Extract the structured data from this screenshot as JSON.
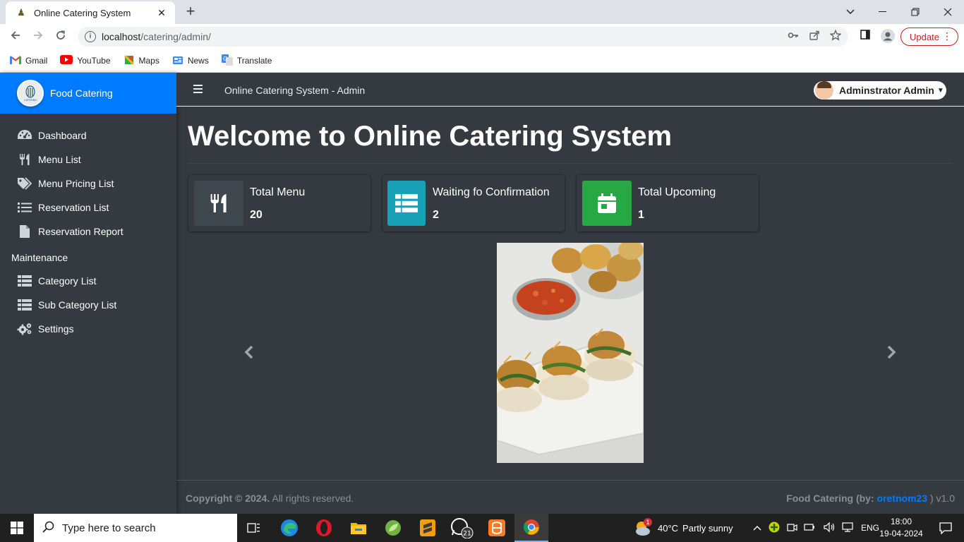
{
  "browser": {
    "tab_title": "Online Catering System",
    "url_host": "localhost",
    "url_path": "/catering/admin/",
    "update_label": "Update",
    "bookmarks": [
      {
        "label": "Gmail",
        "icon": "gmail-icon",
        "color": "#ea4335"
      },
      {
        "label": "YouTube",
        "icon": "youtube-icon",
        "color": "#ff0000"
      },
      {
        "label": "Maps",
        "icon": "maps-icon",
        "color": "#34a853"
      },
      {
        "label": "News",
        "icon": "news-icon",
        "color": "#4285f4"
      },
      {
        "label": "Translate",
        "icon": "translate-icon",
        "color": "#4285f4"
      }
    ]
  },
  "sidebar": {
    "brand": "Food Catering",
    "logo_text": "CATERING",
    "items": [
      {
        "label": "Dashboard",
        "icon": "dashboard-icon"
      },
      {
        "label": "Menu List",
        "icon": "utensils-icon"
      },
      {
        "label": "Menu Pricing List",
        "icon": "tags-icon"
      },
      {
        "label": "Reservation List",
        "icon": "list-icon"
      },
      {
        "label": "Reservation Report",
        "icon": "file-icon"
      }
    ],
    "maintenance_header": "Maintenance",
    "maintenance_items": [
      {
        "label": "Category List",
        "icon": "table-icon"
      },
      {
        "label": "Sub Category List",
        "icon": "table-icon"
      },
      {
        "label": "Settings",
        "icon": "gears-icon"
      }
    ]
  },
  "topnav": {
    "title": "Online Catering System - Admin",
    "user": "Adminstrator Admin"
  },
  "main": {
    "heading": "Welcome to Online Catering System",
    "info_boxes": [
      {
        "label": "Total Menu",
        "value": "20",
        "icon": "utensils-icon",
        "color": "#3f474e"
      },
      {
        "label": "Waiting fo Confirmation",
        "value": "2",
        "icon": "table-list-icon",
        "color": "#17a2b8"
      },
      {
        "label": "Total Upcoming",
        "value": "1",
        "icon": "calendar-icon",
        "color": "#28a745"
      }
    ]
  },
  "footer": {
    "copyright_bold": "Copyright © 2024.",
    "copyright_rest": " All rights reserved.",
    "credit_prefix": "Food Catering (by: ",
    "credit_link": "oretnom23",
    "credit_suffix": " ) v1.0"
  },
  "taskbar": {
    "search_placeholder": "Type here to search",
    "weather_temp": "40°C",
    "weather_desc": "Partly sunny",
    "weather_badge": "1",
    "language": "ENG",
    "time": "18:00",
    "date": "19-04-2024",
    "whatsapp_badge": "21"
  }
}
